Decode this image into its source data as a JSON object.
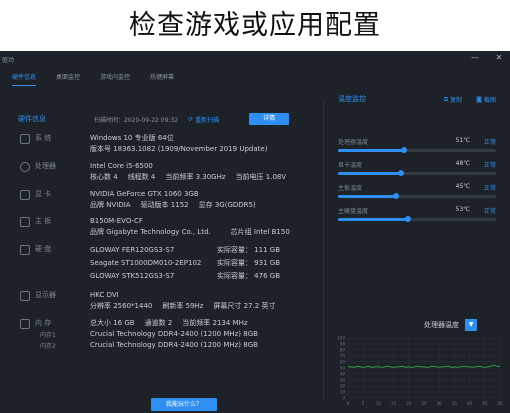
{
  "caption": "检查游戏或应用配置",
  "app": {
    "title": "驱动",
    "tabs": [
      {
        "label": "硬件信息",
        "active": true
      },
      {
        "label": "桌面监控",
        "active": false
      },
      {
        "label": "游戏内监控",
        "active": false
      },
      {
        "label": "热键屏幕",
        "active": false
      }
    ]
  },
  "hardware": {
    "title": "硬件信息",
    "scan_time": "扫描时间：2020-09-22 09:32",
    "rescan_label": "重新扫描",
    "details_label": "详情",
    "system": {
      "label": "系 统",
      "os": "Windows 10 专业版 64位",
      "version": "版本号 18363.1082 (1909/November 2019 Update)"
    },
    "cpu": {
      "label": "处理器",
      "model": "Intel Core i5-6500",
      "cores": "核心数  4",
      "threads": "线程数  4",
      "freq": "当前频率  3.30GHz",
      "voltage": "当前电压  1.08V"
    },
    "gpu": {
      "label": "显 卡",
      "model": "NVIDIA GeForce GTX 1060 3GB",
      "brand": "品牌  NVIDIA",
      "driver": "驱动版本  1152",
      "vram": "显存  3G(GDDR5)"
    },
    "board": {
      "label": "主 板",
      "model": "B150M-EVO-CF",
      "brand": "品牌  Gigabyte Technology Co., Ltd.",
      "chipset": "芯片组  Intel B150"
    },
    "disk": {
      "label": "硬 盘",
      "drives": [
        {
          "name": "GLOWAY FER120GS3-S7",
          "cap": "实际容量： 111 GB"
        },
        {
          "name": "Seagate ST1000DM010-2EP102",
          "cap": "实际容量： 931 GB"
        },
        {
          "name": "GLOWAY STK512GS3-S7",
          "cap": "实际容量： 476 GB"
        }
      ]
    },
    "monitor": {
      "label": "显示器",
      "model": "HKC DVI",
      "resolution": "分辨率  2560*1440",
      "refresh": "刷新率  59Hz",
      "size": "屏幕尺寸  27.2 英寸"
    },
    "memory": {
      "label": "内 存",
      "size": "总大小  16 GB",
      "channel": "通道数  2",
      "freq": "当前频率  2134 MHz",
      "slot1_label": "内存1",
      "slot2_label": "内存2",
      "slot1": "Crucial Technology DDR4-2400 (1200 MHz) 8GB",
      "slot2": "Crucial Technology DDR4-2400 (1200 MHz) 8GB"
    },
    "bottom_button": "我能玩什么？"
  },
  "temperature": {
    "title": "温度监控",
    "copy_label": "复制",
    "screenshot_label": "截图",
    "items": [
      {
        "label": "处理器温度",
        "value": "51℃",
        "status": "正常",
        "level": 0.42
      },
      {
        "label": "显卡温度",
        "value": "48℃",
        "status": "正常",
        "level": 0.4
      },
      {
        "label": "主板温度",
        "value": "45℃",
        "status": "正常",
        "level": 0.37
      },
      {
        "label": "主硬盘温度",
        "value": "53℃",
        "status": "正常",
        "level": 0.44
      }
    ],
    "select_label": "处理器温度",
    "select_arrow": "▼",
    "colors": {
      "accent": "#2f8ff0",
      "line": "#2fae4a"
    }
  },
  "chart_data": {
    "type": "line",
    "title": "",
    "xlabel": "",
    "ylabel": "",
    "ylim": [
      0,
      100
    ],
    "yticks": [
      "100",
      "90",
      "80",
      "70",
      "60",
      "50",
      "40",
      "30",
      "20",
      "10",
      "0"
    ],
    "xticks": [
      "0",
      "5",
      "10",
      "15",
      "20",
      "25",
      "30",
      "35",
      "40",
      "45",
      "50"
    ],
    "grid": true,
    "series": [
      {
        "values": [
          52,
          52,
          51,
          53,
          52,
          51,
          52,
          53,
          51,
          52,
          52,
          51,
          52,
          53,
          52,
          51,
          52,
          52,
          53,
          51,
          52,
          51,
          52,
          53,
          52,
          52,
          51,
          52,
          53,
          52,
          51,
          52,
          52,
          53,
          51,
          52,
          51,
          52,
          53,
          52,
          52,
          51,
          52,
          53,
          52,
          51,
          52,
          53,
          55,
          53,
          52
        ]
      }
    ]
  }
}
